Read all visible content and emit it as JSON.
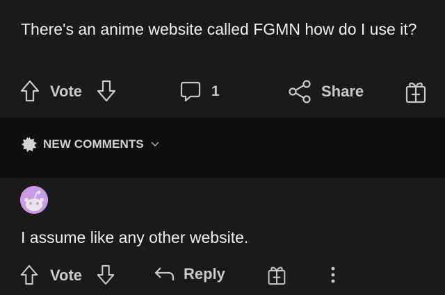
{
  "post": {
    "title": "There's an anime website called FGMN how do I use it?",
    "vote_label": "Vote",
    "comment_count": "1",
    "share_label": "Share"
  },
  "sort": {
    "label": "NEW COMMENTS"
  },
  "comment": {
    "text": "I assume like any other website.",
    "vote_label": "Vote",
    "reply_label": "Reply"
  },
  "icons": {
    "upvote": "arrow-up-outline-icon",
    "downvote": "arrow-down-outline-icon",
    "comments": "speech-bubble-icon",
    "share": "share-nodes-icon",
    "award": "gift-award-icon",
    "sort": "starburst-badge-icon",
    "chevron": "chevron-down-icon",
    "reply": "reply-arrow-icon",
    "more": "vertical-ellipsis-icon"
  },
  "colors": {
    "background": "#1a1a1b",
    "band": "#0f0f10",
    "text": "#eceeef",
    "muted": "#c7cacc",
    "avatar": "#c79be6"
  }
}
